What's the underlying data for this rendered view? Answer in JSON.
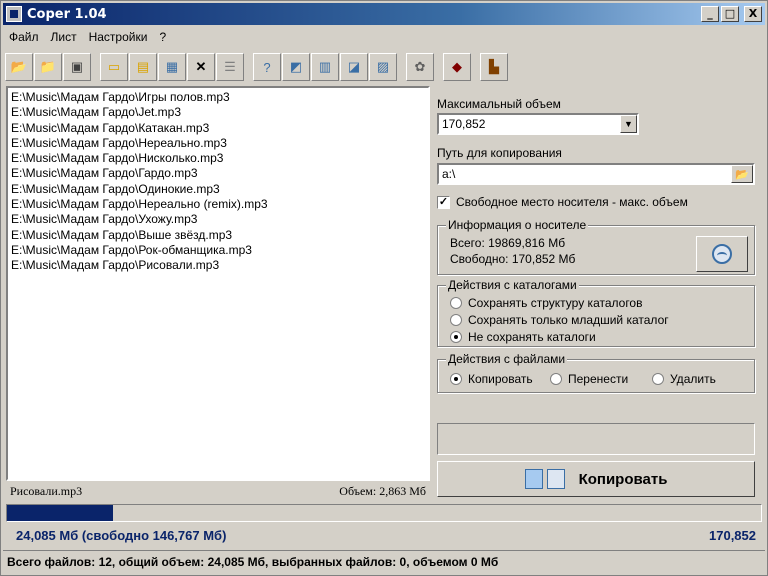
{
  "window": {
    "title": "Coper 1.04"
  },
  "title_buttons": {
    "minimize": "_",
    "maximize": "□",
    "close": "X"
  },
  "menu": [
    "Файл",
    "Лист",
    "Настройки",
    "?"
  ],
  "toolbar": {
    "groups": [
      [
        "open-folder-icon",
        "add-folder-icon",
        "save-icon"
      ],
      [
        "open-file-icon",
        "load-list-icon",
        "drive-icon",
        "delete-icon",
        "clear-list-icon"
      ],
      [
        "help-icon",
        "sort-icon",
        "move-up-icon",
        "move-down-icon",
        "select-icon"
      ],
      [
        "settings-icon"
      ],
      [
        "disk-icon"
      ],
      [
        "exit-icon"
      ]
    ]
  },
  "files": [
    "E:\\Music\\Мадам Гардо\\Игры полов.mp3",
    "E:\\Music\\Мадам Гардо\\Jet.mp3",
    "E:\\Music\\Мадам Гардо\\Катакан.mp3",
    "E:\\Music\\Мадам Гардо\\Нереально.mp3",
    "E:\\Music\\Мадам Гардо\\Нисколько.mp3",
    "E:\\Music\\Мадам Гардо\\Гардо.mp3",
    "E:\\Music\\Мадам Гардо\\Одинокие.mp3",
    "E:\\Music\\Мадам Гардо\\Нереально (remix).mp3",
    "E:\\Music\\Мадам Гардо\\Ухожу.mp3",
    "E:\\Music\\Мадам Гардо\\Выше звёзд.mp3",
    "E:\\Music\\Мадам Гардо\\Рок-обманщика.mp3",
    "E:\\Music\\Мадам Гардо\\Рисовали.mp3"
  ],
  "list_status": {
    "selected": "Рисовали.mp3",
    "size": "Объем: 2,863 Мб"
  },
  "progress": {
    "value": 0.14
  },
  "size_line": {
    "left": "24,085 Мб (свободно 146,767 Мб)",
    "right": "170,852"
  },
  "statusbar": "Всего файлов: 12, общий объем: 24,085 Мб, выбранных файлов: 0, объемом 0 Мб",
  "panel": {
    "max_volume_label": "Максимальный объем",
    "max_volume_value": "170,852",
    "path_label": "Путь для копирования",
    "path_value": "a:\\",
    "free_space_check": "Свободное место носителя - макс. объем",
    "free_space_checked": true,
    "media_info": {
      "title": "Информация о носителе",
      "total": "Всего: 19869,816 Мб",
      "free": "Свободно: 170,852 Мб"
    },
    "catalog_actions": {
      "title": "Действия с каталогами",
      "options": [
        "Сохранять структуру каталогов",
        "Сохранять только младший каталог",
        "Не сохранять каталоги"
      ],
      "selected": 2
    },
    "file_actions": {
      "title": "Действия с файлами",
      "options": [
        "Копировать",
        "Перенести",
        "Удалить"
      ],
      "selected": 0
    },
    "copy_button": "Копировать"
  }
}
